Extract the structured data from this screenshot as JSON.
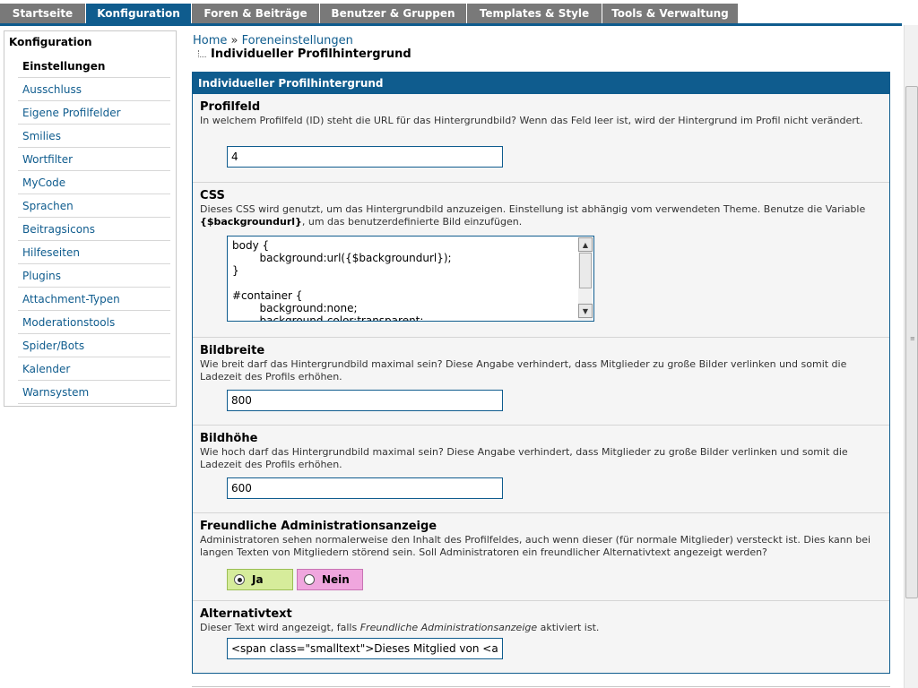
{
  "nav": {
    "tabs": [
      {
        "label": "Startseite",
        "active": false
      },
      {
        "label": "Konfiguration",
        "active": true
      },
      {
        "label": "Foren & Beiträge",
        "active": false
      },
      {
        "label": "Benutzer & Gruppen",
        "active": false
      },
      {
        "label": "Templates & Style",
        "active": false
      },
      {
        "label": "Tools & Verwaltung",
        "active": false
      }
    ]
  },
  "sidebar": {
    "title": "Konfiguration",
    "items": [
      {
        "label": "Einstellungen",
        "active": true
      },
      {
        "label": "Ausschluss",
        "active": false
      },
      {
        "label": "Eigene Profilfelder",
        "active": false
      },
      {
        "label": "Smilies",
        "active": false
      },
      {
        "label": "Wortfilter",
        "active": false
      },
      {
        "label": "MyCode",
        "active": false
      },
      {
        "label": "Sprachen",
        "active": false
      },
      {
        "label": "Beitragsicons",
        "active": false
      },
      {
        "label": "Hilfeseiten",
        "active": false
      },
      {
        "label": "Plugins",
        "active": false
      },
      {
        "label": "Attachment-Typen",
        "active": false
      },
      {
        "label": "Moderationstools",
        "active": false
      },
      {
        "label": "Spider/Bots",
        "active": false
      },
      {
        "label": "Kalender",
        "active": false
      },
      {
        "label": "Warnsystem",
        "active": false
      }
    ]
  },
  "breadcrumb": {
    "home": "Home",
    "separator": "»",
    "parent": "Foreneinstellungen",
    "current": "Individueller Profilhintergrund"
  },
  "panel": {
    "title": "Individueller Profilhintergrund"
  },
  "settings": {
    "profilfeld": {
      "title": "Profilfeld",
      "description": "In welchem Profilfeld (ID) steht die URL für das Hintergrundbild? Wenn das Feld leer ist, wird der Hintergrund im Profil nicht verändert.",
      "value": "4"
    },
    "css": {
      "title": "CSS",
      "description_part1": "Dieses CSS wird genutzt, um das Hintergrundbild anzuzeigen. Einstellung ist abhängig vom verwendeten Theme. Benutze die Variable ",
      "description_variable": "{$backgroundurl}",
      "description_part2": ", um das benutzerdefinierte Bild einzufügen.",
      "value": "body {\n\t\tbackground:url({$backgroundurl});\n}\n\n#container {\n\t\tbackground:none;\n\t\tbackground-color:transparent;"
    },
    "bildbreite": {
      "title": "Bildbreite",
      "description": "Wie breit darf das Hintergrundbild maximal sein? Diese Angabe verhindert, dass Mitglieder zu große Bilder verlinken und somit die Ladezeit des Profils erhöhen.",
      "value": "800"
    },
    "bildhoehe": {
      "title": "Bildhöhe",
      "description": "Wie hoch darf das Hintergrundbild maximal sein? Diese Angabe verhindert, dass Mitglieder zu große Bilder verlinken und somit die Ladezeit des Profils erhöhen.",
      "value": "600"
    },
    "adminanzeige": {
      "title": "Freundliche Administrationsanzeige",
      "description": "Administratoren sehen normalerweise den Inhalt des Profilfeldes, auch wenn dieser (für normale Mitglieder) versteckt ist. Dies kann bei langen Texten von Mitgliedern störend sein. Soll Administratoren ein freundlicher Alternativtext angezeigt werden?",
      "yes_label": "Ja",
      "no_label": "Nein",
      "selected": "yes"
    },
    "alternativtext": {
      "title": "Alternativtext",
      "description_part1": "Dieser Text wird angezeigt, falls ",
      "description_em": "Freundliche Administrationsanzeige",
      "description_part2": " aktiviert ist.",
      "value": "<span class=\"smalltext\">Dieses Mitglied von <a hr"
    }
  },
  "colors": {
    "accent": "#0f5c8e",
    "tab_inactive": "#797979",
    "yes_bg": "#d6ec9b",
    "no_bg": "#f0a6de"
  }
}
